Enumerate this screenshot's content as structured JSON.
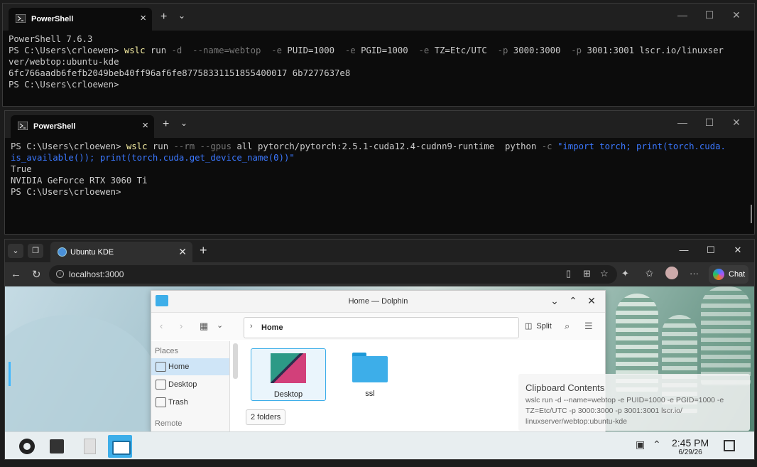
{
  "term1": {
    "tab_title": "PowerShell",
    "new_tab": "+",
    "lines": {
      "l1": "PowerShell 7.6.3",
      "l2_prompt": "PS C:\\Users\\crloewen> ",
      "l2_cmd": "wslc",
      "l2_a": " run ",
      "l2_b": "-d  --name=webtop  -e",
      "l2_c": " PUID=1000  ",
      "l2_d": "-e",
      "l2_e": " PGID=1000  ",
      "l2_f": "-e",
      "l2_g": " TZ=Etc/UTC  ",
      "l2_h": "-p",
      "l2_i": " 3000:3000  ",
      "l2_j": "-p",
      "l2_k": " 3001:3001 lscr.io/linuxser",
      "l3": "ver/webtop:ubuntu-kde",
      "l4": "6fc766aadb6fefb2049beb40ff96af6fe87758331151855400017 6b7277637e8",
      "l5": "PS C:\\Users\\crloewen>"
    }
  },
  "term2": {
    "tab_title": "PowerShell",
    "new_tab": "+",
    "lines": {
      "l1_prompt": "PS C:\\Users\\crloewen> ",
      "l1_cmd": "wslc",
      "l1_a": " run ",
      "l1_b": "--rm --gpus",
      "l1_c": " all pytorch/pytorch:2.5.1-cuda12.4-cudnn9-runtime  python ",
      "l1_d": "-c",
      "l1_e": " \"import torch; print(torch.cuda.",
      "l2": "is_available()); print(torch.cuda.get_device_name(0))\"",
      "l3": "True",
      "l4": "NVIDIA GeForce RTX 3060 Ti",
      "l5": "PS C:\\Users\\crloewen>"
    }
  },
  "browser": {
    "tab_title": "Ubuntu KDE",
    "url": "localhost:3000",
    "chat_label": "Chat"
  },
  "dolphin": {
    "title": "Home — Dolphin",
    "breadcrumb": "Home",
    "split_label": "Split",
    "places_header": "Places",
    "places": [
      "Home",
      "Desktop",
      "Trash"
    ],
    "remote_header": "Remote",
    "files": [
      "Desktop",
      "ssl"
    ],
    "status": "2 folders"
  },
  "clipboard": {
    "title": "Clipboard Contents",
    "body": "wslc run -d  --name=webtop  -e PUID=1000  -e PGID=1000  -e TZ=Etc/UTC  -p 3000:3000  -p 3001:3001 lscr.io/ linuxserver/webtop:ubuntu-kde"
  },
  "taskbar": {
    "time": "2:45 PM",
    "date": "6/29/26"
  }
}
